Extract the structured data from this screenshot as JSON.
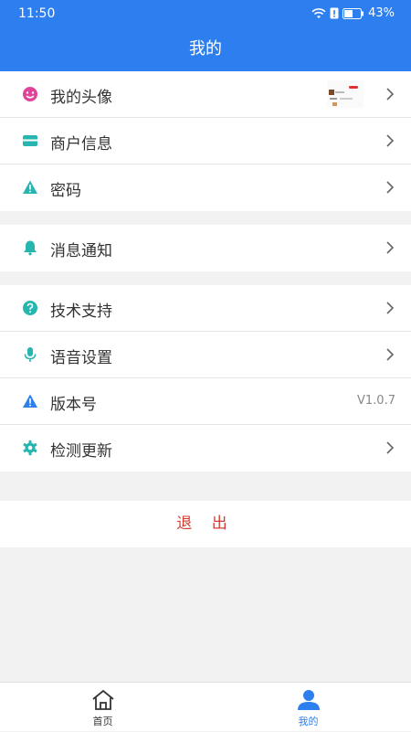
{
  "status_bar": {
    "time": "11:50",
    "battery": "43%"
  },
  "header": {
    "title": "我的"
  },
  "groups": [
    [
      {
        "label": "我的头像",
        "icon": "smile-icon"
      },
      {
        "label": "商户信息",
        "icon": "card-icon"
      },
      {
        "label": "密码",
        "icon": "warning-icon"
      }
    ],
    [
      {
        "label": "消息通知",
        "icon": "bell-icon"
      }
    ],
    [
      {
        "label": "技术支持",
        "icon": "help-icon"
      },
      {
        "label": "语音设置",
        "icon": "mic-icon"
      },
      {
        "label": "版本号",
        "icon": "warning-icon",
        "value": "V1.0.7"
      },
      {
        "label": "检测更新",
        "icon": "gear-icon"
      }
    ]
  ],
  "logout_label": "退 出",
  "tabs": [
    {
      "label": "首页",
      "icon": "home-icon",
      "active": false
    },
    {
      "label": "我的",
      "icon": "user-icon",
      "active": true
    }
  ],
  "colors": {
    "primary": "#2d7ff0",
    "teal_icon": "#27b5b0",
    "pink_icon": "#e0439a",
    "logout_red": "#d43c33",
    "inactive_tab": "#333333"
  }
}
